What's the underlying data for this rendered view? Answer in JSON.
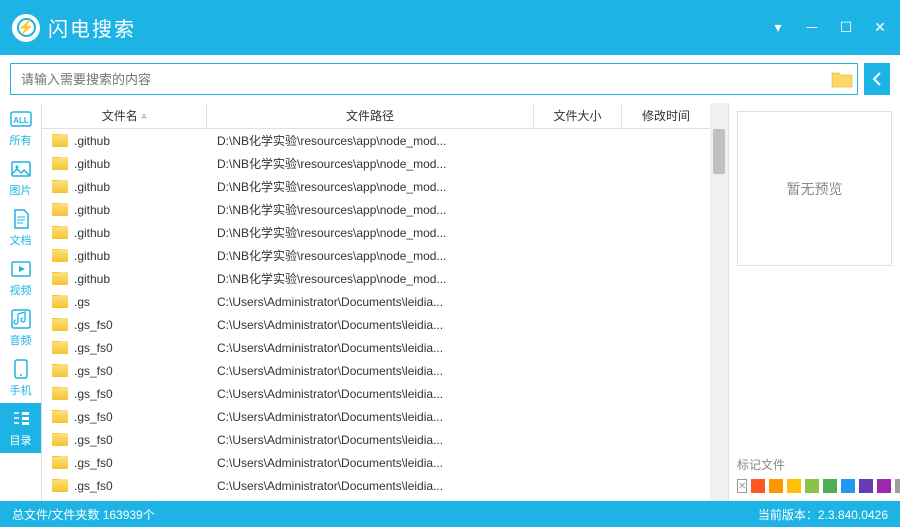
{
  "app": {
    "title": "闪电搜索"
  },
  "search": {
    "placeholder": "请输入需要搜索的内容"
  },
  "sidebar": {
    "items": [
      {
        "label": "所有",
        "icon": "all"
      },
      {
        "label": "图片",
        "icon": "image"
      },
      {
        "label": "文档",
        "icon": "doc"
      },
      {
        "label": "视频",
        "icon": "video"
      },
      {
        "label": "音频",
        "icon": "audio"
      },
      {
        "label": "手机",
        "icon": "phone"
      },
      {
        "label": "目录",
        "icon": "folder"
      }
    ]
  },
  "columns": {
    "name": "文件名",
    "path": "文件路径",
    "size": "文件大小",
    "date": "修改时间"
  },
  "rows": [
    {
      "name": ".github",
      "path": "D:\\NB化学实验\\resources\\app\\node_mod..."
    },
    {
      "name": ".github",
      "path": "D:\\NB化学实验\\resources\\app\\node_mod..."
    },
    {
      "name": ".github",
      "path": "D:\\NB化学实验\\resources\\app\\node_mod..."
    },
    {
      "name": ".github",
      "path": "D:\\NB化学实验\\resources\\app\\node_mod..."
    },
    {
      "name": ".github",
      "path": "D:\\NB化学实验\\resources\\app\\node_mod..."
    },
    {
      "name": ".github",
      "path": "D:\\NB化学实验\\resources\\app\\node_mod..."
    },
    {
      "name": ".github",
      "path": "D:\\NB化学实验\\resources\\app\\node_mod..."
    },
    {
      "name": ".gs",
      "path": "C:\\Users\\Administrator\\Documents\\leidia..."
    },
    {
      "name": ".gs_fs0",
      "path": "C:\\Users\\Administrator\\Documents\\leidia..."
    },
    {
      "name": ".gs_fs0",
      "path": "C:\\Users\\Administrator\\Documents\\leidia..."
    },
    {
      "name": ".gs_fs0",
      "path": "C:\\Users\\Administrator\\Documents\\leidia..."
    },
    {
      "name": ".gs_fs0",
      "path": "C:\\Users\\Administrator\\Documents\\leidia..."
    },
    {
      "name": ".gs_fs0",
      "path": "C:\\Users\\Administrator\\Documents\\leidia..."
    },
    {
      "name": ".gs_fs0",
      "path": "C:\\Users\\Administrator\\Documents\\leidia..."
    },
    {
      "name": ".gs_fs0",
      "path": "C:\\Users\\Administrator\\Documents\\leidia..."
    },
    {
      "name": ".gs_fs0",
      "path": "C:\\Users\\Administrator\\Documents\\leidia..."
    }
  ],
  "preview": {
    "empty": "暂无预览",
    "tag_label": "标记文件"
  },
  "tag_colors": [
    "#ff5722",
    "#ff9800",
    "#ffc107",
    "#8bc34a",
    "#4caf50",
    "#2196f3",
    "#673ab7",
    "#9c27b0",
    "#9e9e9e"
  ],
  "status": {
    "left_label": "总文件/文件夹数",
    "count": "163939个",
    "version_label": "当前版本：",
    "version": "2.3.840.0426"
  }
}
